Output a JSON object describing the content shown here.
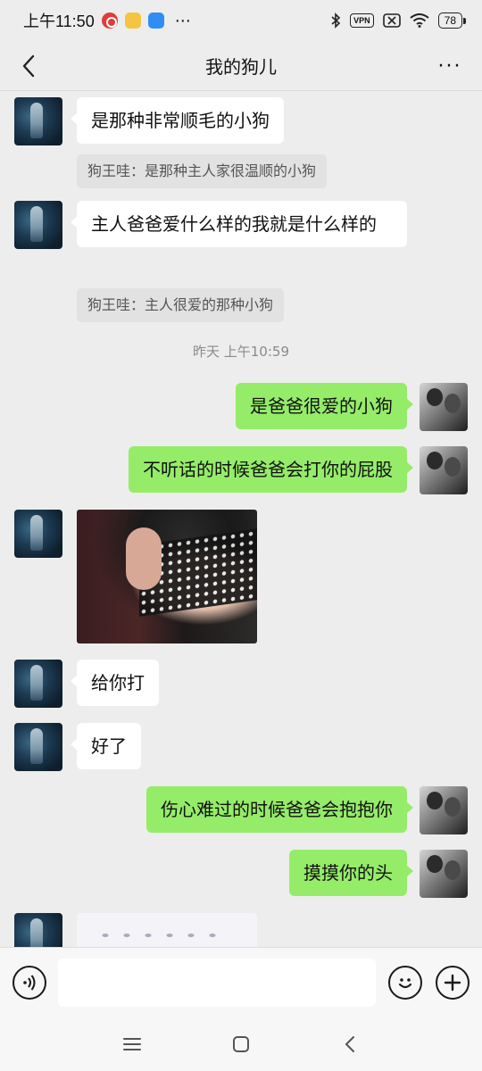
{
  "status_bar": {
    "time": "上午11:50",
    "vpn": "VPN",
    "battery": "78",
    "more": "⋯"
  },
  "header": {
    "title": "我的狗儿",
    "more_label": "···"
  },
  "messages": [
    {
      "side": "left",
      "type": "text",
      "text": "是那种非常顺毛的小狗",
      "quote": "狗王哇：是那种主人家很温顺的小狗"
    },
    {
      "side": "left",
      "type": "text",
      "text": "主人爸爸爱什么样的我就是什么样的",
      "quote": "狗王哇：主人很爱的那种小狗"
    },
    {
      "type": "timestamp",
      "text": "昨天 上午10:59"
    },
    {
      "side": "right",
      "type": "text",
      "text": "是爸爸很爱的小狗"
    },
    {
      "side": "right",
      "type": "text",
      "text": "不听话的时候爸爸会打你的屁股"
    },
    {
      "side": "left",
      "type": "image"
    },
    {
      "side": "left",
      "type": "text",
      "text": "给你打"
    },
    {
      "side": "left",
      "type": "text",
      "text": "好了"
    },
    {
      "side": "right",
      "type": "text",
      "text": "伤心难过的时候爸爸会抱抱你"
    },
    {
      "side": "right",
      "type": "text",
      "text": "摸摸你的头"
    },
    {
      "side": "left",
      "type": "image"
    }
  ],
  "input": {
    "value": "",
    "placeholder": ""
  },
  "colors": {
    "background": "#ededed",
    "bubble_self": "#95ec69",
    "bubble_other": "#ffffff",
    "quote_bg": "#e2e2e2"
  },
  "icons": {
    "back": "chevron-left-icon",
    "voice": "voice-icon",
    "emoji": "emoji-icon",
    "add": "plus-icon",
    "nav_menu": "menu-icon",
    "nav_home": "home-icon",
    "nav_back": "back-icon"
  }
}
